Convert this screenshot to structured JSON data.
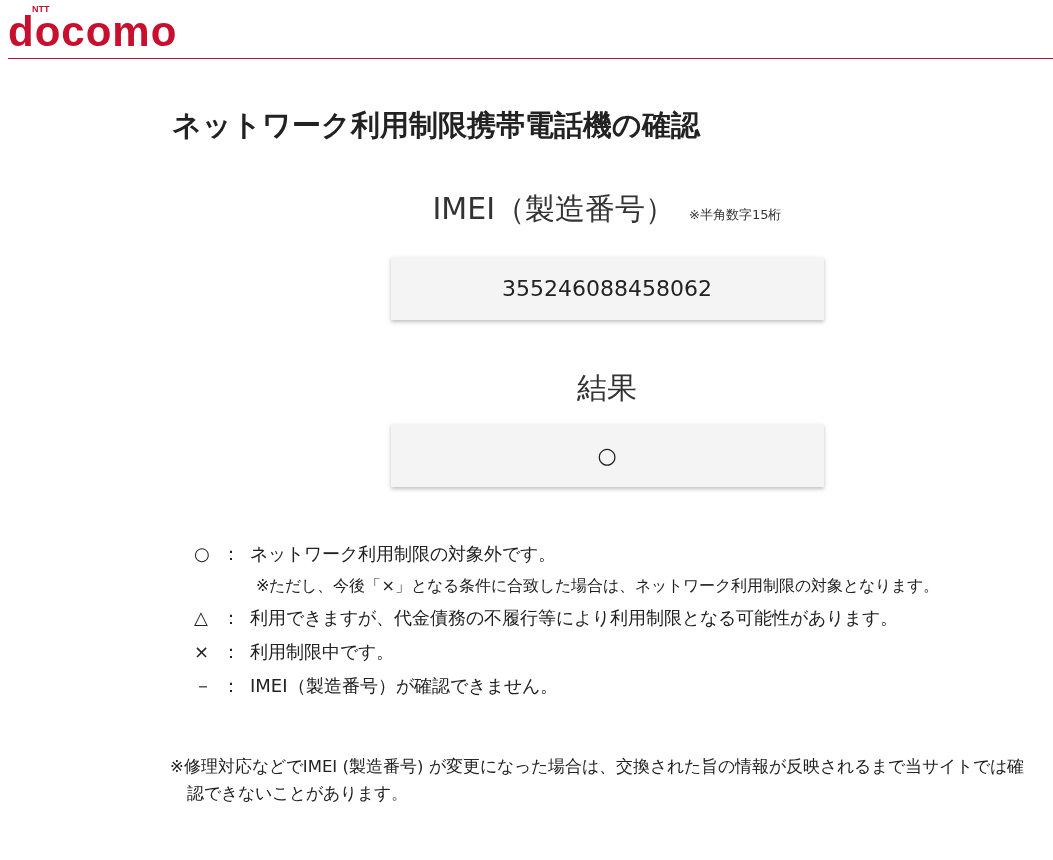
{
  "logo": {
    "brand": "NTT",
    "name": "docomo"
  },
  "title": "ネットワーク利用制限携帯電話機の確認",
  "imei": {
    "label": "IMEI（製造番号）",
    "note": "※半角数字15桁",
    "value": "355246088458062"
  },
  "result": {
    "label": "結果",
    "value": "○"
  },
  "legend": [
    {
      "symbol": "○",
      "sep": "：",
      "text": "ネットワーク利用制限の対象外です。",
      "note": "※ただし、今後「×」となる条件に合致した場合は、ネットワーク利用制限の対象となります。"
    },
    {
      "symbol": "△",
      "sep": "：",
      "text": "利用できますが、代金債務の不履行等により利用制限となる可能性があります。"
    },
    {
      "symbol": "×",
      "sep": "：",
      "text": "利用制限中です。"
    },
    {
      "symbol": "－",
      "sep": "：",
      "text": "IMEI（製造番号）が確認できません。"
    }
  ],
  "footnote": "※修理対応などでIMEI (製造番号) が変更になった場合は、交換された旨の情報が反映されるまで当サイトでは確認できないことがあります。"
}
